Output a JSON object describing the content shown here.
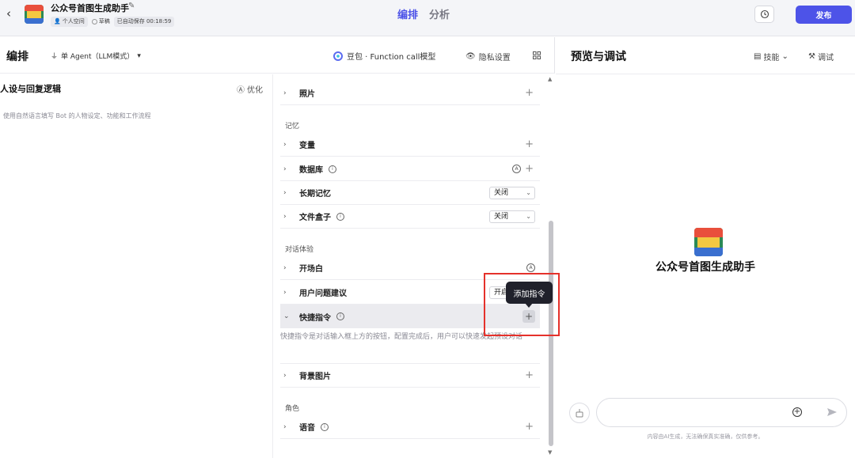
{
  "topbar": {
    "bot_name": "公众号首图生成助手",
    "space": "个人空间",
    "status": "草稿",
    "autosave": "已自动保存 00:18:59",
    "tabs": [
      {
        "label": "编排",
        "active": true
      },
      {
        "label": "分析",
        "active": false
      }
    ],
    "publish": "发布"
  },
  "editor": {
    "title": "编排",
    "agent_mode": "单 Agent（LLM模式）",
    "model": "豆包 · Function call模型",
    "privacy": "隐私设置"
  },
  "persona": {
    "title": "人设与回复逻辑",
    "optimize": "优化",
    "placeholder": "使用自然语言填写 Bot 的人物设定、功能和工作流程"
  },
  "skills": {
    "photo": "照片",
    "memory_section": "记忆",
    "variables": "变量",
    "database": "数据库",
    "long_memory": "长期记忆",
    "long_memory_value": "关闭",
    "file_box": "文件盒子",
    "file_box_value": "关闭",
    "dialog_section": "对话体验",
    "opening": "开场白",
    "suggestions": "用户问题建议",
    "suggestions_value": "开启",
    "shortcuts": "快捷指令",
    "shortcuts_desc": "快捷指令是对话输入框上方的按钮，配置完成后，用户可以快速发起预设对话",
    "background": "背景图片",
    "role_section": "角色",
    "voice": "语音",
    "tooltip": "添加指令"
  },
  "preview": {
    "title": "预览与调试",
    "skills": "技能",
    "debug": "调试",
    "bot_name": "公众号首图生成助手",
    "disclaimer": "内容由AI生成，无法确保真实准确，仅供参考。"
  },
  "colors": {
    "accent": "#4d53e8",
    "highlight": "#e5312b",
    "tooltip_bg": "#20212b"
  }
}
